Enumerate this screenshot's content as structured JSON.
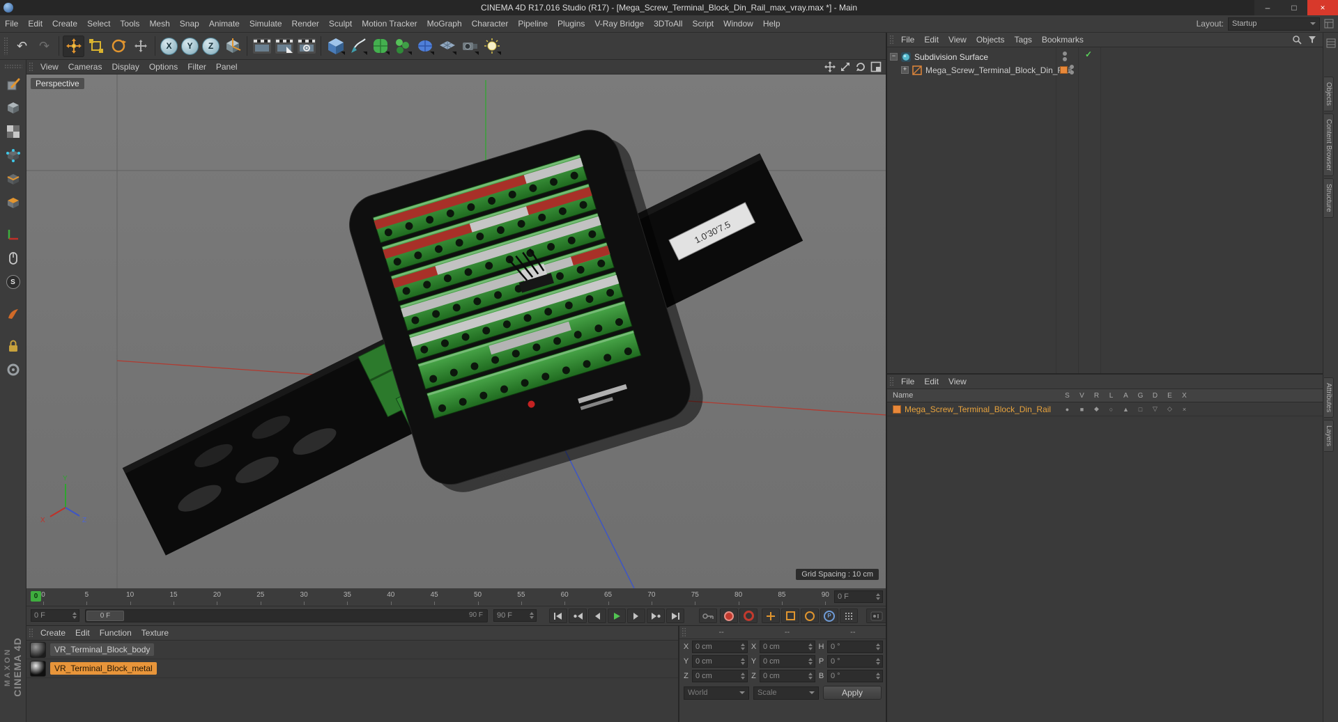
{
  "window": {
    "title": "CINEMA 4D R17.016 Studio (R17) - [Mega_Screw_Terminal_Block_Din_Rail_max_vray.max *] - Main"
  },
  "menubar": {
    "items": [
      "File",
      "Edit",
      "Create",
      "Select",
      "Tools",
      "Mesh",
      "Snap",
      "Animate",
      "Simulate",
      "Render",
      "Sculpt",
      "Motion Tracker",
      "MoGraph",
      "Character",
      "Pipeline",
      "Plugins",
      "V-Ray Bridge",
      "3DToAll",
      "Script",
      "Window",
      "Help"
    ],
    "layout_label": "Layout:",
    "layout_value": "Startup"
  },
  "toolbar": {
    "axis_locks": [
      "X",
      "Y",
      "Z"
    ]
  },
  "viewport": {
    "menu": [
      "View",
      "Cameras",
      "Display",
      "Options",
      "Filter",
      "Panel"
    ],
    "label": "Perspective",
    "grid_spacing": "Grid Spacing : 10 cm",
    "rail_label": "1.0'30'7.5",
    "axis": {
      "x": "X",
      "y": "Y",
      "z": "Z"
    }
  },
  "object_manager": {
    "menu": [
      "File",
      "Edit",
      "View",
      "Objects",
      "Tags",
      "Bookmarks"
    ],
    "rows": [
      {
        "label": "Subdivision Surface"
      },
      {
        "label": "Mega_Screw_Terminal_Block_Din_Rail"
      }
    ]
  },
  "attribute_panel": {
    "menu": [
      "File",
      "Edit",
      "View"
    ],
    "name_header": "Name",
    "columns": [
      "S",
      "V",
      "R",
      "L",
      "A",
      "G",
      "D",
      "E",
      "X"
    ],
    "layer_label": "Mega_Screw_Terminal_Block_Din_Rail",
    "toggle_glyphs": [
      "●",
      "■",
      "◆",
      "○",
      "▲",
      "□",
      "▽",
      "◇",
      "×"
    ]
  },
  "side_tabs": {
    "top": [
      "Objects",
      "Content Browser",
      "Structure"
    ],
    "bottom": [
      "Attributes",
      "Layers"
    ]
  },
  "timeline": {
    "ticks": [
      "0",
      "5",
      "10",
      "15",
      "20",
      "25",
      "30",
      "35",
      "40",
      "45",
      "50",
      "55",
      "60",
      "65",
      "70",
      "75",
      "80",
      "85",
      "90"
    ],
    "playhead": "0",
    "frame_spinner": "0 F",
    "current_frame_field": "0 F",
    "slider_handle": "0 F",
    "slider_end": "90 F",
    "end_frame_field": "90 F"
  },
  "materials": {
    "menu": [
      "Create",
      "Edit",
      "Function",
      "Texture"
    ],
    "items": [
      {
        "label": "VR_Terminal_Block_body",
        "selected": false
      },
      {
        "label": "VR_Terminal_Block_metal",
        "selected": true
      }
    ]
  },
  "coordinates": {
    "headers": [
      "--",
      "--",
      "--"
    ],
    "rows": [
      {
        "pl": "X",
        "pv": "0 cm",
        "sl": "X",
        "sv": "0 cm",
        "rl": "H",
        "rv": "0 °"
      },
      {
        "pl": "Y",
        "pv": "0 cm",
        "sl": "Y",
        "sv": "0 cm",
        "rl": "P",
        "rv": "0 °"
      },
      {
        "pl": "Z",
        "pv": "0 cm",
        "sl": "Z",
        "sv": "0 cm",
        "rl": "B",
        "rv": "0 °"
      }
    ],
    "system": "World",
    "size_mode": "Scale",
    "apply": "Apply"
  },
  "branding": {
    "line1": "MAXON",
    "line2": "CINEMA 4D"
  },
  "icons": {
    "undo": "↶",
    "redo": "↷",
    "minimize": "–",
    "maximize": "□",
    "close": "×",
    "check": "✓",
    "collapse": "−",
    "expand": "+",
    "parameter": "P",
    "solo": "S"
  }
}
